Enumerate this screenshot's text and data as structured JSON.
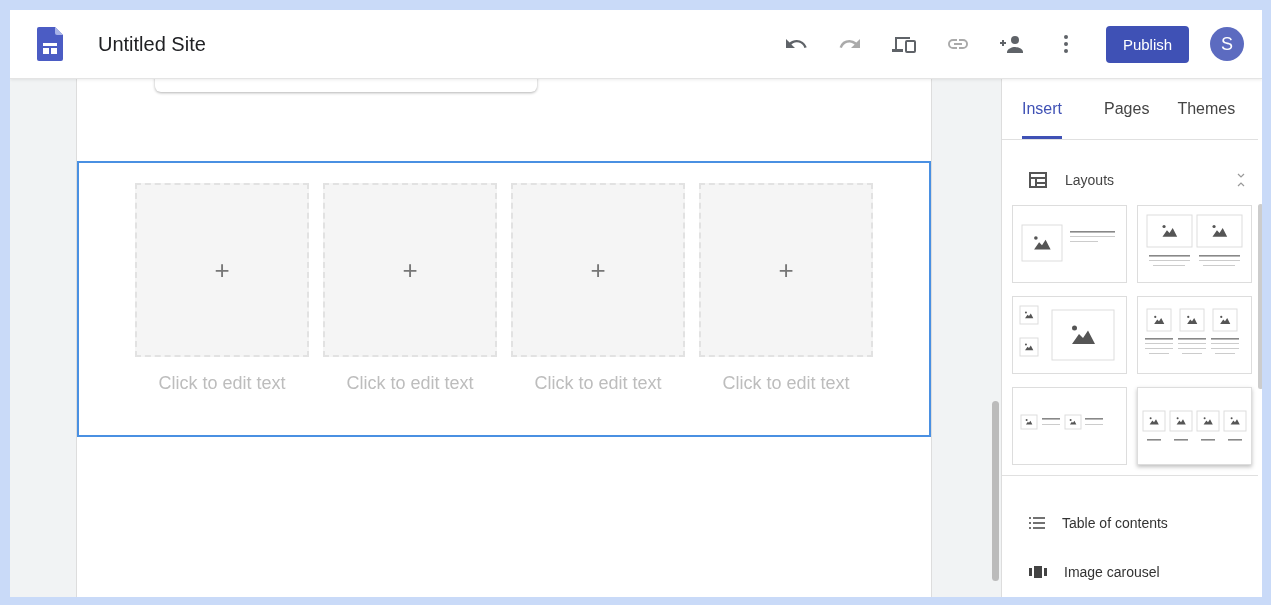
{
  "header": {
    "title": "Untitled Site",
    "toolbar": [
      {
        "kind": "undo",
        "disabled": false
      },
      {
        "kind": "redo",
        "disabled": true
      },
      {
        "kind": "devices",
        "disabled": false
      },
      {
        "kind": "link",
        "disabled": true
      },
      {
        "kind": "share",
        "disabled": false
      },
      {
        "kind": "more",
        "disabled": false
      }
    ],
    "publish": "Publish",
    "avatar": "S"
  },
  "canvas": {
    "section": {
      "selected": true,
      "items": [
        {
          "add": "+",
          "caption": "Click to edit text"
        },
        {
          "add": "+",
          "caption": "Click to edit text"
        },
        {
          "add": "+",
          "caption": "Click to edit text"
        },
        {
          "add": "+",
          "caption": "Click to edit text"
        }
      ]
    }
  },
  "panel": {
    "tabs": [
      {
        "label": "Insert",
        "selected": true
      },
      {
        "label": "Pages",
        "selected": false
      },
      {
        "label": "Themes",
        "selected": false
      }
    ],
    "layouts": {
      "title": "Layouts",
      "expanded": true,
      "options": [
        {
          "kind": "image-text",
          "selected": false
        },
        {
          "kind": "two-images",
          "selected": false
        },
        {
          "kind": "mixed-images",
          "selected": false
        },
        {
          "kind": "three-columns",
          "selected": false
        },
        {
          "kind": "two-image-text",
          "selected": false
        },
        {
          "kind": "four-columns",
          "selected": true
        }
      ]
    },
    "items": [
      {
        "kind": "toc",
        "label": "Table of contents"
      },
      {
        "kind": "carousel",
        "label": "Image carousel"
      }
    ]
  }
}
